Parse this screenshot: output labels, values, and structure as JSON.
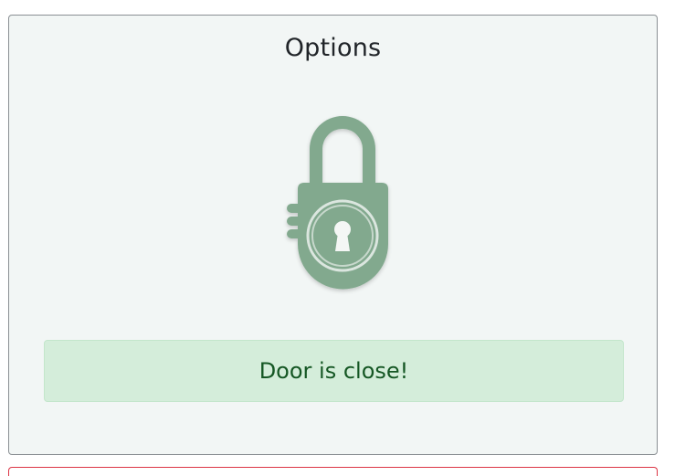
{
  "card": {
    "title": "Options"
  },
  "lock": {
    "icon": "padlock-icon",
    "state": "locked",
    "color": "#82a98e"
  },
  "status": {
    "message": "Door is close!",
    "bg_color": "#d4edda",
    "text_color": "#155724"
  },
  "colors": {
    "card_bg": "#f2f6f5",
    "next_card_border": "#dc3545"
  }
}
